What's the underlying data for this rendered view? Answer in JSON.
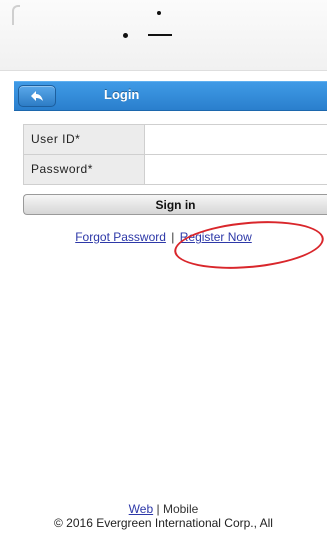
{
  "header": {
    "back_icon": "back-arrow-icon",
    "title": "Login",
    "bar_color": "#2f86d6"
  },
  "form": {
    "user_id_label": "User ID*",
    "user_id_value": "",
    "password_label": "Password*",
    "password_value": ""
  },
  "sign_in_label": "Sign in",
  "links": {
    "forgot_password": "Forgot Password",
    "separator": "|",
    "register_now": "Register Now",
    "link_color": "#2d38a8"
  },
  "annotation": {
    "ring_color": "#d9262b"
  },
  "footer": {
    "web_link": "Web",
    "separator": "|",
    "mobile_label": "Mobile",
    "copyright": "© 2016 Evergreen International Corp., All"
  }
}
